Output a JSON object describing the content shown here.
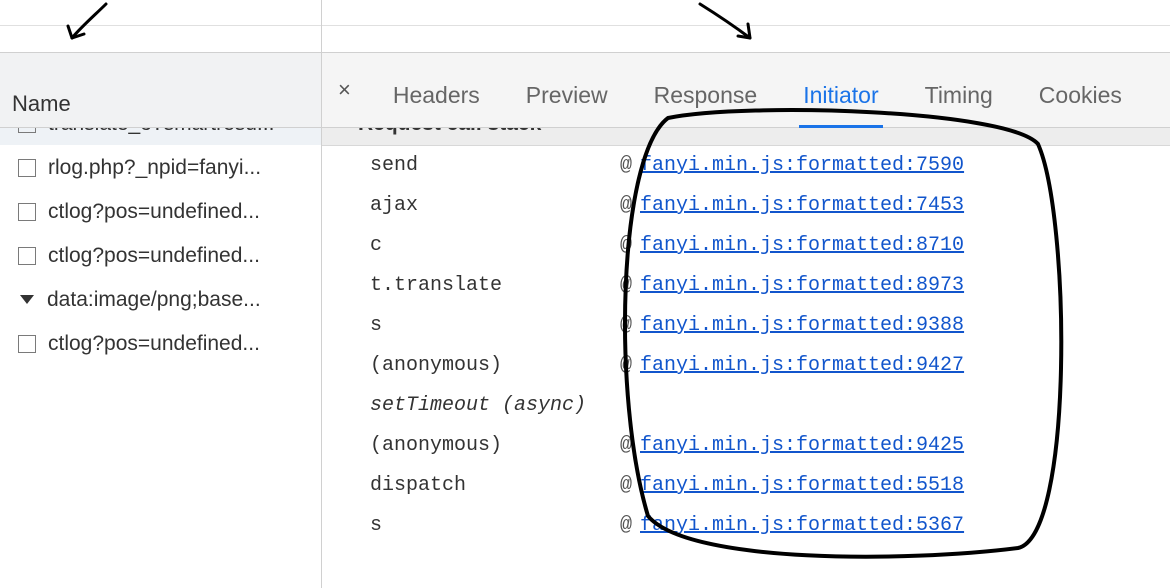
{
  "leftPanel": {
    "header": "Name",
    "items": [
      {
        "label": "translate_o?smartresu...",
        "selected": true,
        "hasTri": false
      },
      {
        "label": "rlog.php?_npid=fanyi...",
        "selected": false,
        "hasTri": false
      },
      {
        "label": "ctlog?pos=undefined...",
        "selected": false,
        "hasTri": false
      },
      {
        "label": "ctlog?pos=undefined...",
        "selected": false,
        "hasTri": false
      },
      {
        "label": "data:image/png;base...",
        "selected": false,
        "hasTri": true
      },
      {
        "label": "ctlog?pos=undefined...",
        "selected": false,
        "hasTri": false
      }
    ]
  },
  "tabs": {
    "close": "×",
    "items": [
      {
        "label": "Headers",
        "active": false
      },
      {
        "label": "Preview",
        "active": false
      },
      {
        "label": "Response",
        "active": false
      },
      {
        "label": "Initiator",
        "active": true
      },
      {
        "label": "Timing",
        "active": false
      },
      {
        "label": "Cookies",
        "active": false
      }
    ]
  },
  "section": {
    "title": "Request call stack"
  },
  "stack": [
    {
      "fn": "send",
      "italic": false,
      "src": "fanyi.min.js:formatted:7590"
    },
    {
      "fn": "ajax",
      "italic": false,
      "src": "fanyi.min.js:formatted:7453"
    },
    {
      "fn": "c",
      "italic": false,
      "src": "fanyi.min.js:formatted:8710"
    },
    {
      "fn": "t.translate",
      "italic": false,
      "src": "fanyi.min.js:formatted:8973"
    },
    {
      "fn": "s",
      "italic": false,
      "src": "fanyi.min.js:formatted:9388"
    },
    {
      "fn": "(anonymous)",
      "italic": false,
      "src": "fanyi.min.js:formatted:9427"
    },
    {
      "fn": "setTimeout (async)",
      "italic": true,
      "src": ""
    },
    {
      "fn": "(anonymous)",
      "italic": false,
      "src": "fanyi.min.js:formatted:9425"
    },
    {
      "fn": "dispatch",
      "italic": false,
      "src": "fanyi.min.js:formatted:5518"
    },
    {
      "fn": "s",
      "italic": false,
      "src": "fanyi.min.js:formatted:5367"
    }
  ],
  "atSymbol": "@"
}
